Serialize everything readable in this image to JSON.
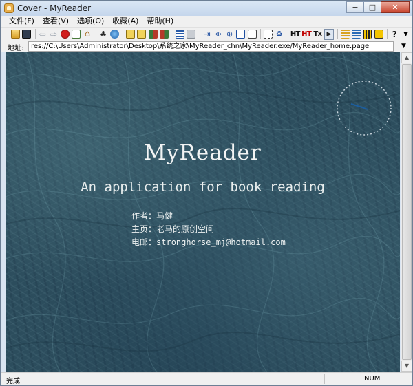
{
  "window": {
    "title": "Cover - MyReader",
    "controls": {
      "minimize": "−",
      "maximize": "□",
      "close": "✕"
    }
  },
  "menu": [
    "文件(F)",
    "查看(V)",
    "选项(O)",
    "收藏(A)",
    "帮助(H)"
  ],
  "toolbar": {
    "icons": [
      "open-icon",
      "save-icon",
      "back-icon",
      "forward-icon",
      "stop-icon",
      "refresh-icon",
      "home-icon",
      "find-icon",
      "search-web-icon",
      "book-prev-icon",
      "book-next-icon",
      "book-open-icon",
      "book-close-icon",
      "list-icon",
      "page-icon",
      "text-fit-icon",
      "split-icon",
      "zoom-icon",
      "export-icon",
      "copy-icon",
      "crop-icon",
      "recycle-icon",
      "ht-icon",
      "ht-red-icon",
      "tx-icon",
      "player-icon",
      "tree-icon",
      "tree-alt-icon",
      "grid-icon",
      "chart-icon",
      "help-icon",
      "dropdown-icon"
    ],
    "text_buttons": {
      "ht": "HT",
      "ht_red": "HT",
      "tx": "Tx"
    }
  },
  "address": {
    "label": "地址:",
    "value": "res://C:\\Users\\Administrator\\Desktop\\系统之家\\MyReader_chn\\MyReader.exe/MyReader_home.page"
  },
  "content": {
    "title": "MyReader",
    "subtitle": "An application for book reading",
    "info": [
      {
        "label": "作者：",
        "value": "马健"
      },
      {
        "label": "主页：",
        "value": "老马的原创空间"
      },
      {
        "label": "电邮：",
        "value": "stronghorse_mj@hotmail.com"
      }
    ],
    "colors": {
      "background": "#2c4d5d",
      "text": "#f2f4f4",
      "clock_hand": "#1c5d9e"
    }
  },
  "status": {
    "text": "完成",
    "num": "NUM"
  }
}
